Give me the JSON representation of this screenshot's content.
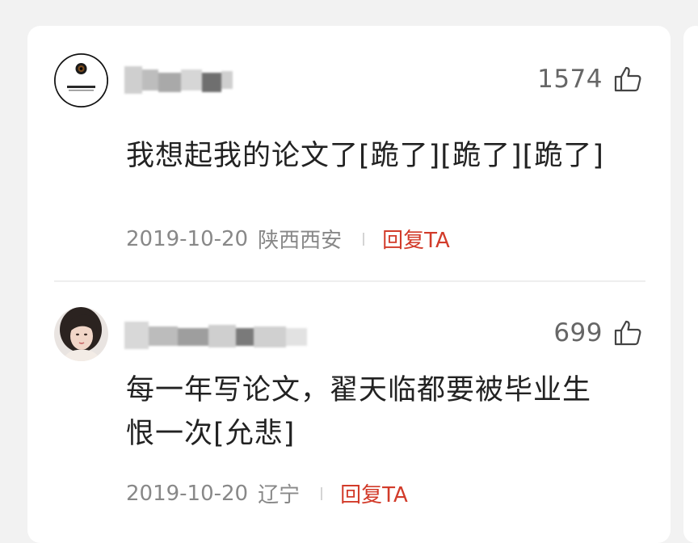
{
  "comments": [
    {
      "likes": "1574",
      "text": "我想起我的论文了[跪了][跪了][跪了]",
      "date": "2019-10-20",
      "location": "陕西西安",
      "reply_label": "回复TA"
    },
    {
      "likes": "699",
      "text_line1": "每一年写论文，翟天临都要被毕业生",
      "text_line2": "恨一次[允悲]",
      "date": "2019-10-20",
      "location": "辽宁",
      "reply_label": "回复TA"
    }
  ],
  "colors": {
    "reply_accent": "#d23b2a",
    "meta_text": "#888888",
    "body_text": "#222222"
  },
  "icons": [
    "thumbs-up-icon",
    "eye-logo-avatar",
    "portrait-avatar"
  ]
}
